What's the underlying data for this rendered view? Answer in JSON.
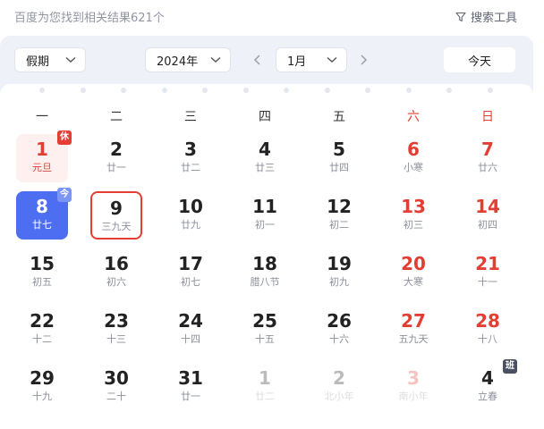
{
  "top": {
    "result_count": "百度为您找到相关结果621个",
    "search_tools": "搜索工具"
  },
  "toolbar": {
    "holiday": "假期",
    "year": "2024年",
    "month": "1月",
    "today": "今天"
  },
  "weekdays": [
    "一",
    "二",
    "三",
    "四",
    "五",
    "六",
    "日"
  ],
  "weeks": [
    [
      {
        "num": "1",
        "lunar": "元旦",
        "state": "holiday",
        "badge": "休",
        "badge_type": "rest"
      },
      {
        "num": "2",
        "lunar": "廿一"
      },
      {
        "num": "3",
        "lunar": "廿二"
      },
      {
        "num": "4",
        "lunar": "廿三"
      },
      {
        "num": "5",
        "lunar": "廿四"
      },
      {
        "num": "6",
        "lunar": "小寒",
        "red": true
      },
      {
        "num": "7",
        "lunar": "廿六",
        "red": true
      }
    ],
    [
      {
        "num": "8",
        "lunar": "廿七",
        "state": "today",
        "badge": "今",
        "badge_type": "today-badge"
      },
      {
        "num": "9",
        "lunar": "三九天",
        "state": "selected"
      },
      {
        "num": "10",
        "lunar": "廿九"
      },
      {
        "num": "11",
        "lunar": "初一"
      },
      {
        "num": "12",
        "lunar": "初二"
      },
      {
        "num": "13",
        "lunar": "初三",
        "red": true
      },
      {
        "num": "14",
        "lunar": "初四",
        "red": true
      }
    ],
    [
      {
        "num": "15",
        "lunar": "初五"
      },
      {
        "num": "16",
        "lunar": "初六"
      },
      {
        "num": "17",
        "lunar": "初七"
      },
      {
        "num": "18",
        "lunar": "腊八节"
      },
      {
        "num": "19",
        "lunar": "初九"
      },
      {
        "num": "20",
        "lunar": "大寒",
        "red": true
      },
      {
        "num": "21",
        "lunar": "十一",
        "red": true
      }
    ],
    [
      {
        "num": "22",
        "lunar": "十二"
      },
      {
        "num": "23",
        "lunar": "十三"
      },
      {
        "num": "24",
        "lunar": "十四"
      },
      {
        "num": "25",
        "lunar": "十五"
      },
      {
        "num": "26",
        "lunar": "十六"
      },
      {
        "num": "27",
        "lunar": "五九天",
        "red": true
      },
      {
        "num": "28",
        "lunar": "十八",
        "red": true
      }
    ],
    [
      {
        "num": "29",
        "lunar": "十九"
      },
      {
        "num": "30",
        "lunar": "二十"
      },
      {
        "num": "31",
        "lunar": "廿一"
      },
      {
        "num": "1",
        "lunar": "廿二",
        "state": "faded"
      },
      {
        "num": "2",
        "lunar": "北小年",
        "state": "faded"
      },
      {
        "num": "3",
        "lunar": "南小年",
        "red": true,
        "state": "faded"
      },
      {
        "num": "4",
        "lunar": "立春",
        "badge": "班",
        "badge_type": "work"
      }
    ]
  ],
  "colors": {
    "accent": "#4e6ef2",
    "weekend_red": "#e33e33",
    "card_bg": "#eef1f8"
  }
}
